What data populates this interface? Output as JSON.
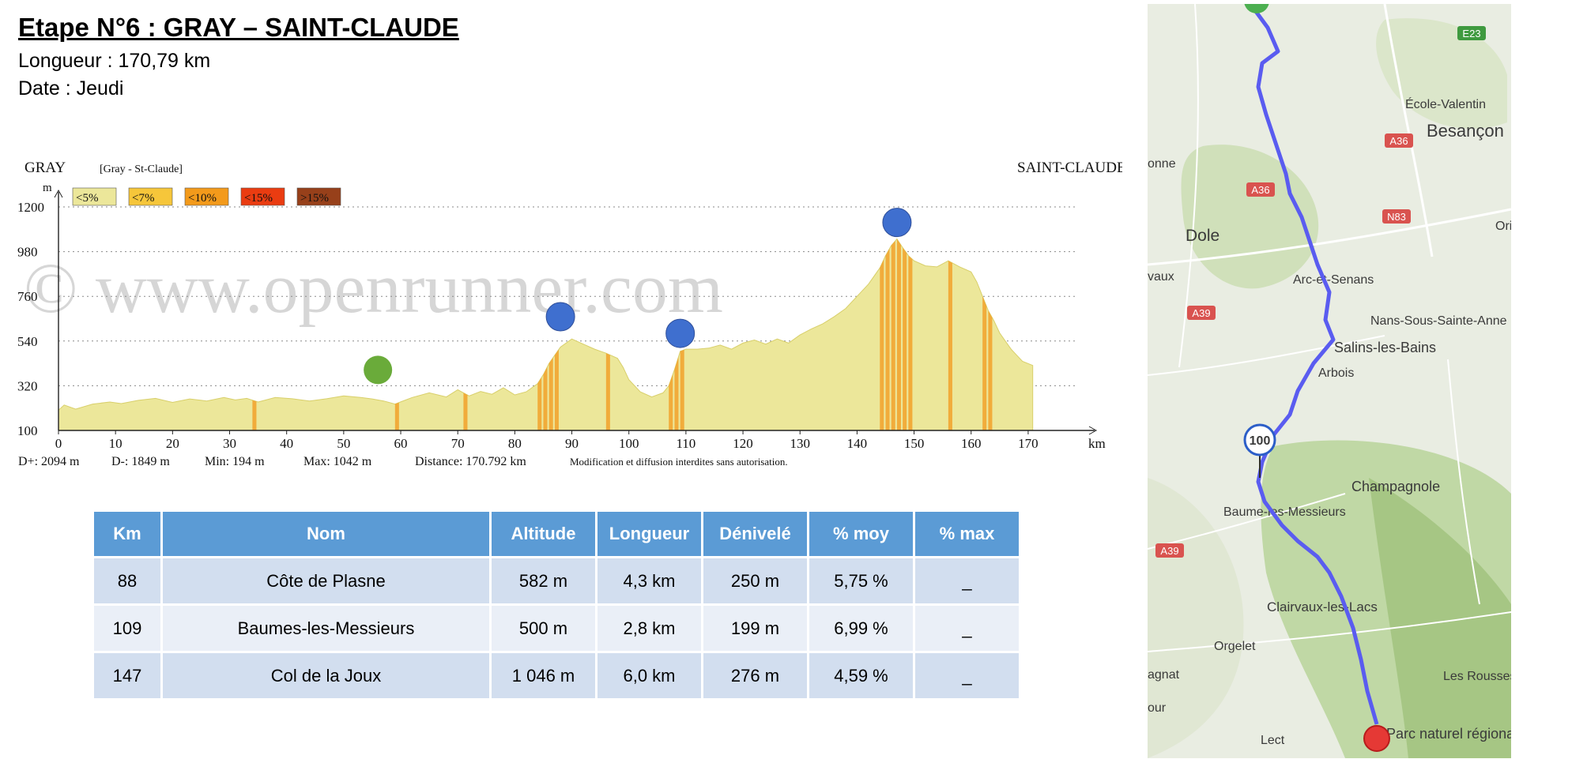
{
  "header": {
    "title": "Etape N°6 : GRAY – SAINT-CLAUDE",
    "length": "Longueur : 170,79 km",
    "date": "Date : Jeudi"
  },
  "profile": {
    "start_label": "GRAY",
    "route_label": "[Gray - St-Claude]",
    "end_label": "SAINT-CLAUDE",
    "y_unit": "m",
    "x_unit": "km",
    "legend": [
      {
        "label": "<5%",
        "color": "#ece79a"
      },
      {
        "label": "<7%",
        "color": "#f6c63a"
      },
      {
        "label": "<10%",
        "color": "#f39a1b"
      },
      {
        "label": "<15%",
        "color": "#ea3c11"
      },
      {
        "label": ">15%",
        "color": "#97401a"
      }
    ],
    "watermark": "© www.openrunner.com",
    "stats": {
      "dplus": "D+: 2094 m",
      "dminus": "D-: 1849 m",
      "min": "Min: 194 m",
      "max": "Max: 1042 m",
      "distance": "Distance: 170.792 km",
      "notice": "Modification et diffusion interdites sans autorisation."
    }
  },
  "chart_data": {
    "type": "area",
    "xlabel": "km",
    "ylabel": "m",
    "xlim": [
      0,
      175
    ],
    "ylim": [
      100,
      1200
    ],
    "xticks": [
      0,
      10,
      20,
      30,
      40,
      50,
      60,
      70,
      80,
      90,
      100,
      110,
      120,
      130,
      140,
      150,
      160,
      170
    ],
    "yticks": [
      100,
      320,
      540,
      760,
      980,
      1200
    ],
    "grid": true,
    "series": [
      {
        "x": [
          0,
          1,
          3,
          6,
          9,
          11,
          14,
          17,
          20,
          23,
          26,
          29,
          31,
          33,
          35,
          38,
          41,
          44,
          47,
          50,
          53,
          55,
          57,
          59,
          62,
          65,
          68,
          70,
          72,
          74,
          76,
          78,
          80,
          82,
          84,
          85,
          86,
          87,
          88,
          90,
          92,
          94,
          96,
          98,
          99,
          100,
          102,
          104,
          106,
          107,
          108,
          109,
          110,
          112,
          114,
          116,
          118,
          120,
          122,
          124,
          126,
          128,
          130,
          132,
          134,
          136,
          138,
          140,
          142,
          144,
          145,
          146,
          147,
          148,
          149,
          150,
          152,
          154,
          156,
          158,
          160,
          161,
          162,
          163,
          164,
          165,
          166,
          167,
          168,
          169,
          170.8
        ],
        "y": [
          200,
          225,
          205,
          230,
          240,
          232,
          248,
          258,
          238,
          255,
          245,
          262,
          250,
          258,
          240,
          262,
          256,
          245,
          256,
          270,
          262,
          255,
          245,
          230,
          262,
          285,
          265,
          300,
          270,
          292,
          278,
          310,
          275,
          290,
          330,
          375,
          430,
          470,
          510,
          550,
          525,
          500,
          480,
          455,
          410,
          350,
          290,
          265,
          285,
          320,
          400,
          490,
          500,
          500,
          505,
          520,
          500,
          530,
          545,
          525,
          550,
          530,
          570,
          600,
          625,
          660,
          700,
          760,
          820,
          900,
          960,
          1010,
          1042,
          1000,
          960,
          935,
          910,
          905,
          935,
          905,
          880,
          830,
          760,
          690,
          640,
          580,
          540,
          500,
          470,
          440,
          420
        ],
        "color": "#ece79a"
      }
    ],
    "steep_km": [
      34,
      59,
      71,
      84,
      85,
      86,
      87,
      96,
      107,
      108,
      109,
      144,
      145,
      146,
      147,
      148,
      149,
      156,
      162,
      163
    ],
    "markers": [
      {
        "km": 56,
        "alt": 320,
        "kind": "start",
        "color": "#6aab3a"
      },
      {
        "km": 88,
        "alt": 582,
        "kind": "climb",
        "color": "#3f6fcf"
      },
      {
        "km": 109,
        "alt": 500,
        "kind": "climb",
        "color": "#3f6fcf"
      },
      {
        "km": 147,
        "alt": 1046,
        "kind": "climb",
        "color": "#3f6fcf"
      }
    ]
  },
  "climbs_table": {
    "columns": [
      "Km",
      "Nom",
      "Altitude",
      "Longueur",
      "Dénivelé",
      "% moy",
      "% max"
    ],
    "rows": [
      [
        "88",
        "Côte de Plasne",
        "582 m",
        "4,3 km",
        "250 m",
        "5,75 %",
        "_"
      ],
      [
        "109",
        "Baumes-les-Messieurs",
        "500 m",
        "2,8 km",
        "199 m",
        "6,99 %",
        "_"
      ],
      [
        "147",
        "Col de la Joux",
        "1 046 m",
        "6,0 km",
        "276 m",
        "4,59 %",
        "_"
      ]
    ]
  },
  "map": {
    "labels": [
      "École-Valentin",
      "Besançon",
      "Dole",
      "Arc-et-Senans",
      "Nans-Sous-Sainte-Anne",
      "Salins-les-Bains",
      "Arbois",
      "Champagnole",
      "Baume-les-Messieurs",
      "Clairvaux-les-Lacs",
      "Orgelet",
      "Les Rousses",
      "Lect",
      "Parc naturel régional du",
      "onne",
      "vaux",
      "agnat",
      "our",
      "Ori"
    ],
    "road_badges": [
      "E23",
      "A36",
      "A36",
      "N83",
      "A39",
      "A39"
    ],
    "km_marker": "100",
    "route_color": "#5a5cf0",
    "start_color": "#4caf50",
    "end_color": "#e53935"
  }
}
